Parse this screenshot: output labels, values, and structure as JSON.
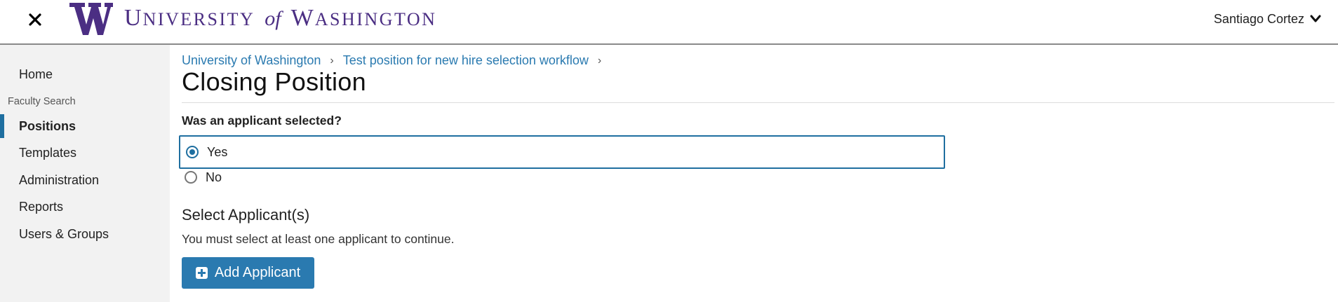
{
  "header": {
    "logo": {
      "word_part1": "U",
      "word_part2": "NIVERSITY",
      "word_of": "of",
      "word_part3": "W",
      "word_part4": "ASHINGTON"
    },
    "close_icon": "close-icon",
    "user_name": "Santiago Cortez",
    "user_menu_icon": "chevron-down-icon"
  },
  "sidebar": {
    "home": "Home",
    "section_label": "Faculty Search",
    "items": [
      "Positions",
      "Templates",
      "Administration",
      "Reports",
      "Users & Groups"
    ],
    "active_item": "Positions"
  },
  "breadcrumb": [
    "University of Washington",
    "Test position for new hire selection workflow"
  ],
  "page_title": "Closing Position",
  "question": {
    "label": "Was an applicant selected?",
    "options": [
      "Yes",
      "No"
    ],
    "selected": "Yes"
  },
  "select_section": {
    "title": "Select Applicant(s)",
    "helper": "You must select at least one applicant to continue.",
    "add_button": "Add Applicant"
  },
  "colors": {
    "brand_purple": "#4b2e83",
    "accent_blue": "#2a7ab0",
    "focus_border": "#1f6fa0"
  }
}
